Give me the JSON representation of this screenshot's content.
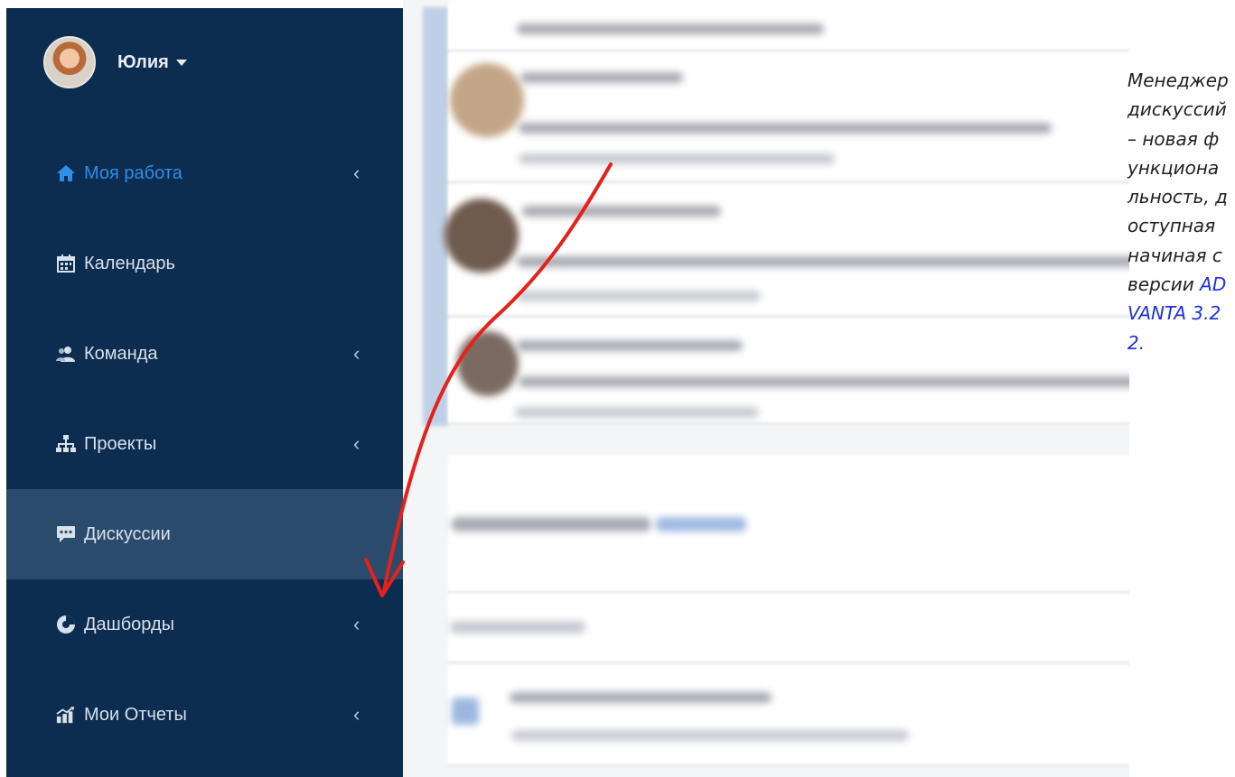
{
  "user": {
    "name": "Юлия"
  },
  "nav": {
    "items": [
      {
        "label": "Моя работа",
        "icon": "home-icon",
        "has_chevron": true,
        "current": true
      },
      {
        "label": "Календарь",
        "icon": "calendar-icon",
        "has_chevron": false
      },
      {
        "label": "Команда",
        "icon": "team-icon",
        "has_chevron": true
      },
      {
        "label": "Проекты",
        "icon": "sitemap-icon",
        "has_chevron": true
      },
      {
        "label": "Дискуссии",
        "icon": "chat-icon",
        "has_chevron": false,
        "active": true
      },
      {
        "label": "Дашборды",
        "icon": "pie-chart-icon",
        "has_chevron": true
      },
      {
        "label": "Мои Отчеты",
        "icon": "bar-chart-icon",
        "has_chevron": true
      }
    ],
    "chevron": "‹"
  },
  "note": {
    "text": "Менеджер дискуссий – новая функциональность, доступная начиная с версии ",
    "link": "ADVANTA 3.22."
  },
  "colors": {
    "sidebar_bg": "#0c2c50",
    "active_item_bg": "#2b4b6d",
    "current_item_text": "#2f8fe6",
    "arrow": "#e5211a",
    "link": "#1b2ff0"
  }
}
